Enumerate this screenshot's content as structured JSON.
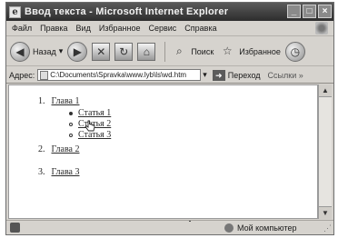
{
  "window": {
    "title": "Ввод текста - Microsoft Internet Explorer",
    "buttons": {
      "minimize": "_",
      "maximize": "□",
      "close": "×"
    }
  },
  "menu": [
    "Файл",
    "Правка",
    "Вид",
    "Избранное",
    "Сервис",
    "Справка"
  ],
  "toolbar": {
    "back_label": "Назад",
    "search_label": "Поиск",
    "favorites_label": "Избранное"
  },
  "address": {
    "label": "Адрес:",
    "value": "C:\\Documents\\Spravka\\www.lyb\\ls\\wd.htm",
    "go_label": "Переход",
    "links_label": "Ссылки »"
  },
  "content": {
    "items": [
      {
        "number": "1.",
        "label": "Глава 1",
        "children": [
          "Статья 1",
          "Статья 2",
          "Статья 3"
        ]
      },
      {
        "number": "2.",
        "label": "Глава 2"
      },
      {
        "number": "3.",
        "label": "Глава 3"
      }
    ]
  },
  "status": {
    "zone": "Мой компьютер"
  },
  "icons": {
    "back": "back-arrow-icon",
    "forward": "forward-arrow-icon",
    "stop": "stop-icon",
    "refresh": "refresh-icon",
    "home": "home-icon",
    "search": "search-icon",
    "favorites": "star-icon",
    "history": "history-icon"
  }
}
